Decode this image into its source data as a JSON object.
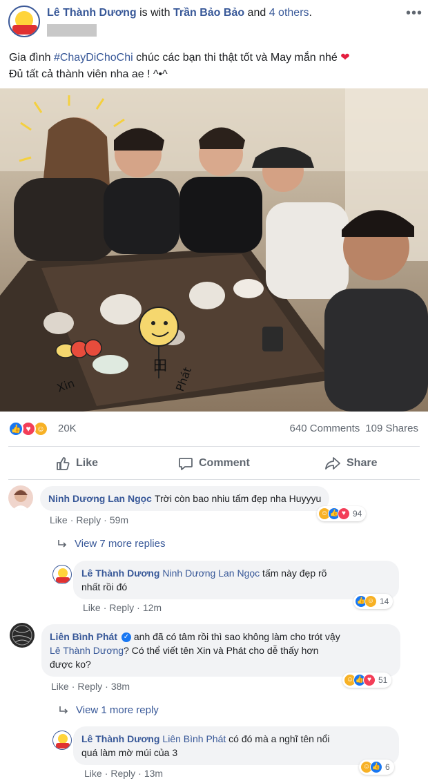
{
  "post": {
    "author": "Lê Thành Dương",
    "with_text": " is with ",
    "tagged_friend": "Trần Bảo Bảo",
    "and_text": " and ",
    "others": "4 others",
    "period": ".",
    "more_glyph": "•••",
    "caption_line1_prefix": "Gia đình ",
    "hashtag": "#ChayDiChoChi",
    "caption_line1_suffix": " chúc các bạn thi thật tốt và May mắn nhé ",
    "heart_emoji": "❤",
    "caption_line2": "Đủ tất cả thành viên nha ae ! ^•^"
  },
  "photo": {
    "doodle_name_left": "Xin",
    "doodle_name_right": "Phát",
    "doodle_shirt": "田"
  },
  "stats": {
    "reaction_icons": [
      "like-icon",
      "love-icon",
      "haha-icon"
    ],
    "reaction_count": "20K",
    "comments": "640 Comments",
    "shares": "109 Shares"
  },
  "actions": {
    "like": "Like",
    "comment": "Comment",
    "share": "Share"
  },
  "comments": [
    {
      "name": "Ninh Dương Lan Ngọc",
      "text": "Trời còn bao nhiu tấm đẹp nha Huyyyu",
      "like": "Like",
      "reply": "Reply",
      "time": "59m",
      "reaction_count": "94",
      "view_more": "View 7 more replies",
      "reply_item": {
        "name": "Lê Thành Dương",
        "mention": "Ninh Dương Lan Ngọc",
        "text_line1": " tấm này đẹp rõ",
        "text_line2": "nhất rồi đó",
        "like": "Like",
        "reply": "Reply",
        "time": "12m",
        "reaction_count": "14"
      }
    },
    {
      "name": "Liên Bình Phát",
      "verified_glyph": "✓",
      "text_line1": "anh đã có tâm rồi thì sao không làm cho trót vậy",
      "mention": "Lê Thành Dương",
      "text_line2": "? Có thể viết tên Xin và Phát cho dễ thấy hơn",
      "text_line3": "được ko?",
      "like": "Like",
      "reply": "Reply",
      "time": "38m",
      "reaction_count": "51",
      "view_more": "View 1 more reply",
      "reply_item": {
        "name": "Lê Thành Dương",
        "mention": "Liên Bình Phát",
        "text_line1": " có đó mà a nghĩ tên nổi",
        "text_line2": "quá làm mờ múi của 3",
        "like": "Like",
        "reply": "Reply",
        "time": "13m",
        "reaction_count": "6"
      }
    }
  ],
  "colors": {
    "link_blue": "#385898",
    "like_blue": "#1877f2",
    "love_red": "#f33e58",
    "haha_yellow": "#f7b125",
    "bubble_bg": "#f2f3f5"
  }
}
